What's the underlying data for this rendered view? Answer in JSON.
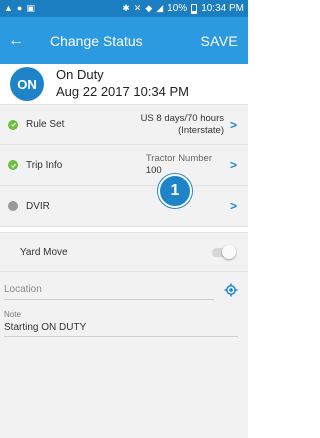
{
  "statusbar": {
    "left_icons": [
      "alert-icon",
      "record-icon",
      "image-icon"
    ],
    "right_icons": [
      "bluetooth-icon",
      "mute-icon",
      "wifi-icon",
      "signal-icon"
    ],
    "battery": "10%",
    "time": "10:34 PM"
  },
  "appbar": {
    "back_icon": "←",
    "title": "Change Status",
    "save_label": "SAVE",
    "color": "#2c9ae0"
  },
  "status": {
    "badge": "ON",
    "name": "On Duty",
    "datetime": "Aug 22 2017 10:34 PM"
  },
  "rows": {
    "rule_set": {
      "label": "Rule Set",
      "value_line1": "US 8 days/70 hours",
      "value_line2": "(Interstate)",
      "status": "ok"
    },
    "trip_info": {
      "label": "Trip Info",
      "value_line1": "Tractor Number",
      "value_line2": "100",
      "status": "ok"
    },
    "dvir": {
      "label": "DVIR",
      "status": "pending"
    }
  },
  "callout": {
    "number": "1"
  },
  "yard_move": {
    "label": "Yard Move",
    "enabled": false
  },
  "location": {
    "placeholder": "Location",
    "value": ""
  },
  "note": {
    "label": "Note",
    "value": "Starting ON DUTY"
  }
}
